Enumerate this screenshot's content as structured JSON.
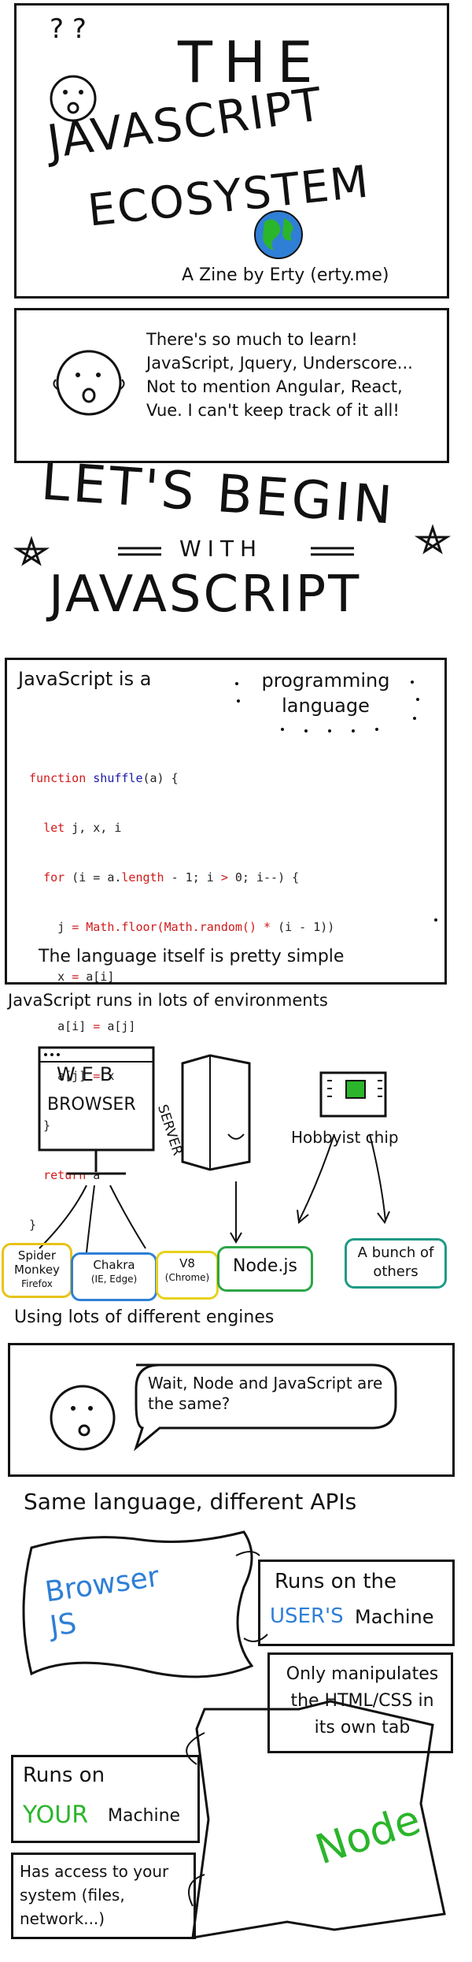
{
  "cover": {
    "question_marks": "? ?",
    "title_line1": "THE",
    "title_line2": "JAVASCRIPT",
    "title_line3": "ECOSYSTEM",
    "byline": "A Zine by Erty (erty.me)"
  },
  "intro": {
    "speech": "There's so much to learn! JavaScript, Jquery, Underscore... Not to mention Angular, React, Vue. I can't keep track of it all!"
  },
  "begin": {
    "line1": "LET'S BEGIN",
    "line2": "WITH",
    "line3": "JAVASCRIPT"
  },
  "language_panel": {
    "lead": "JavaScript is a",
    "highlight": "programming language",
    "code_lines": [
      "function shuffle(a) {",
      "  let j, x, i",
      "  for (i = a.length - 1; i > 0; i--) {",
      "    j = Math.floor(Math.random() * (i - 1))",
      "    x = a[i]",
      "    a[i] = a[j]",
      "    a[j] = x",
      "  }",
      "  return a",
      "}"
    ],
    "caption": "The language itself is pretty simple"
  },
  "environments": {
    "heading": "JavaScript runs in lots of environments",
    "browser_label_1": "WEB",
    "browser_label_2": "BROWSER",
    "server_label": "SERVER",
    "chip_label": "Hobbyist chip",
    "engines": [
      {
        "name": "Spider Monkey",
        "sub": "Firefox",
        "color": "#e8c31a"
      },
      {
        "name": "Chakra",
        "sub": "(IE, Edge)",
        "color": "#2f7fd6"
      },
      {
        "name": "V8",
        "sub": "(Chrome)",
        "color": "#e8d21a"
      },
      {
        "name": "Node.js",
        "sub": "",
        "color": "#2da548"
      },
      {
        "name": "A bunch of others",
        "sub": "",
        "color": "#1f9a86"
      }
    ],
    "caption": "Using lots of different engines"
  },
  "question_panel": {
    "speech": "Wait, Node and JavaScript are the same?"
  },
  "apis": {
    "heading": "Same language, different APIs",
    "browser_js": "Browser JS",
    "runs_on_prefix": "Runs on the",
    "runs_on_highlight": "USER'S",
    "runs_on_suffix": "Machine",
    "only_manip": "Only manipulates the HTML/CSS in its own tab",
    "node_runs_prefix": "Runs on",
    "node_runs_highlight": "YOUR",
    "node_runs_suffix": "Machine",
    "node_access": "Has access to your system (files, network...)",
    "node_label": "Node",
    "colors": {
      "blue": "#2f7fd6",
      "green": "#2bb52b"
    }
  }
}
